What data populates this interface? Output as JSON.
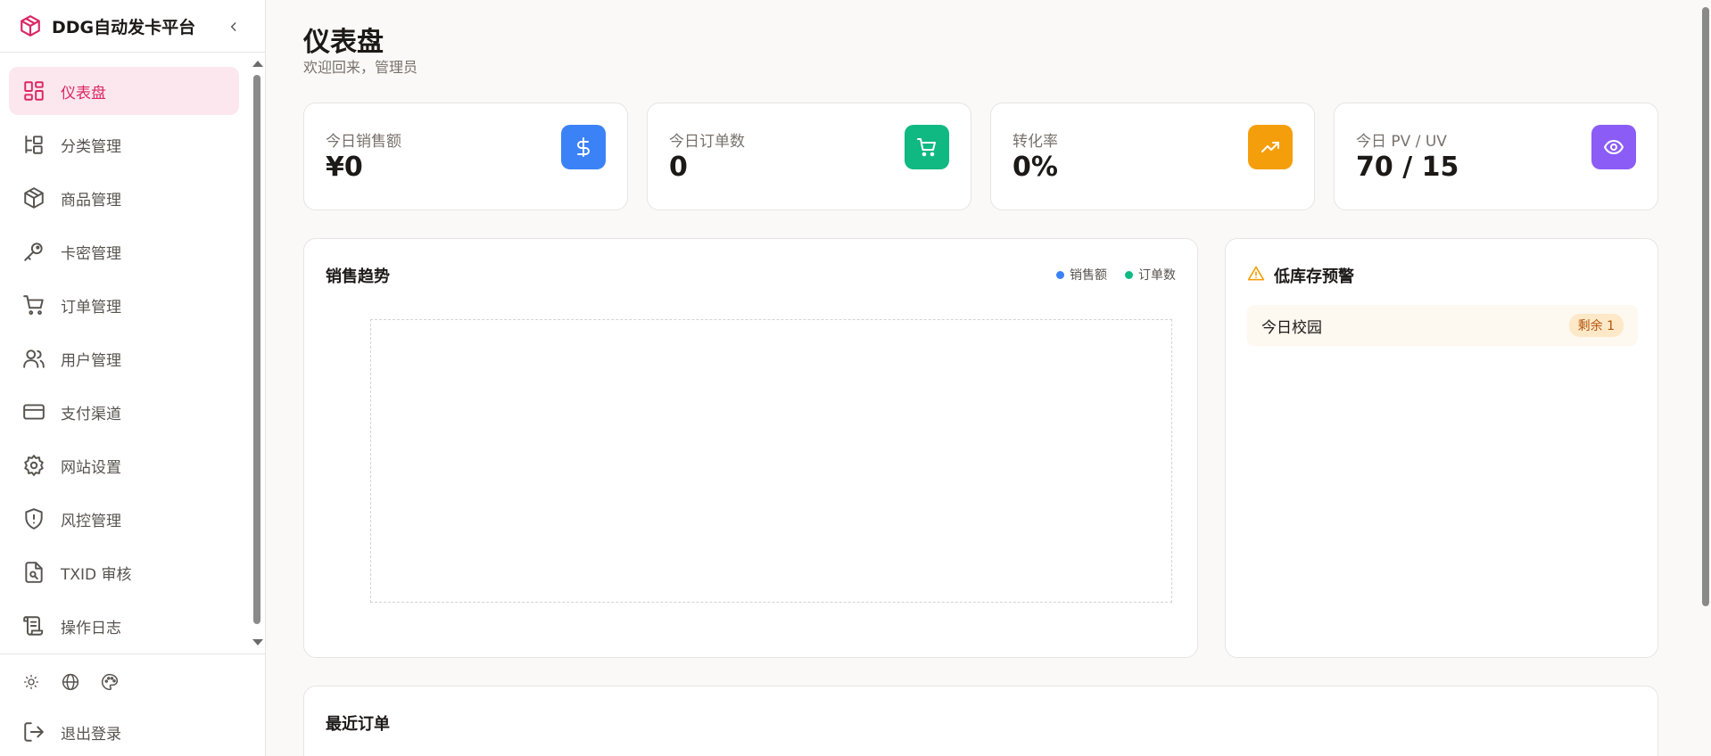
{
  "brand": {
    "title": "DDG自动发卡平台",
    "accent": "#db2763"
  },
  "sidebar": {
    "items": [
      {
        "label": "仪表盘",
        "icon": "dashboard-icon"
      },
      {
        "label": "分类管理",
        "icon": "category-tree-icon"
      },
      {
        "label": "商品管理",
        "icon": "box-icon"
      },
      {
        "label": "卡密管理",
        "icon": "key-icon"
      },
      {
        "label": "订单管理",
        "icon": "cart-icon"
      },
      {
        "label": "用户管理",
        "icon": "users-icon"
      },
      {
        "label": "支付渠道",
        "icon": "credit-card-icon"
      },
      {
        "label": "网站设置",
        "icon": "gear-icon"
      },
      {
        "label": "风控管理",
        "icon": "shield-alert-icon"
      },
      {
        "label": "TXID 审核",
        "icon": "file-search-icon"
      },
      {
        "label": "操作日志",
        "icon": "scroll-icon"
      }
    ],
    "active_index": 0,
    "footer": {
      "logout_label": "退出登录"
    }
  },
  "header": {
    "title": "仪表盘",
    "subtitle": "欢迎回来，管理员"
  },
  "stats": [
    {
      "label": "今日销售额",
      "value": "¥0",
      "icon": "dollar-icon",
      "color": "#3b82f6"
    },
    {
      "label": "今日订单数",
      "value": "0",
      "icon": "cart-icon",
      "color": "#10b981"
    },
    {
      "label": "转化率",
      "value": "0%",
      "icon": "trending-up-icon",
      "color": "#f59e0b"
    },
    {
      "label": "今日 PV / UV",
      "value": "70 / 15",
      "icon": "eye-icon",
      "color": "#8b5cf6"
    }
  ],
  "sales_trend": {
    "title": "销售趋势",
    "legend": [
      {
        "label": "销售额",
        "color": "#3b82f6"
      },
      {
        "label": "订单数",
        "color": "#10b981"
      }
    ]
  },
  "low_stock": {
    "title": "低库存预警",
    "items": [
      {
        "name": "今日校园",
        "badge": "剩余 1"
      }
    ]
  },
  "recent_orders": {
    "title": "最近订单"
  }
}
